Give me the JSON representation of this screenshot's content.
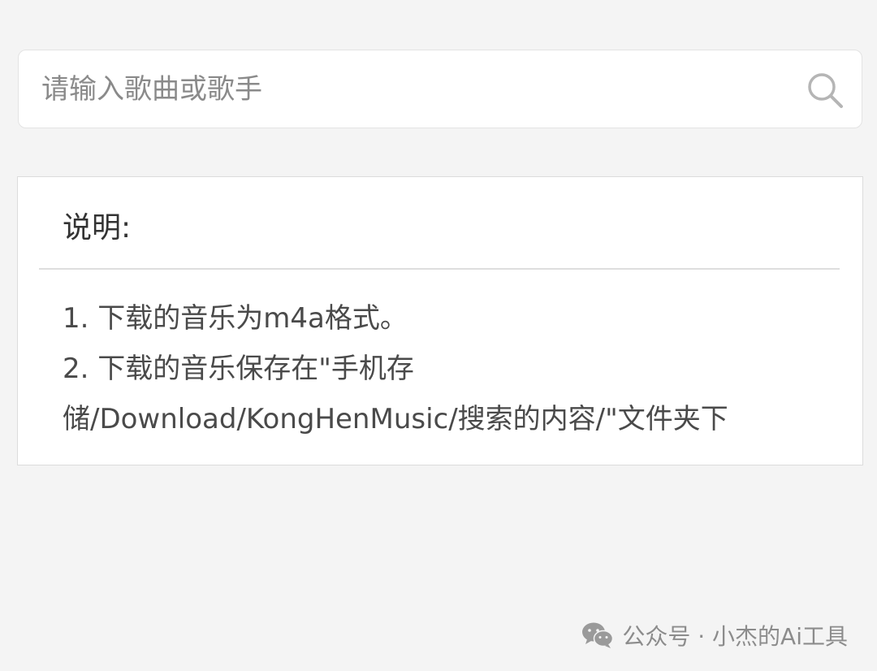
{
  "search": {
    "placeholder": "请输入歌曲或歌手",
    "icon": "search-icon"
  },
  "info": {
    "title": "说明:",
    "items": [
      "1. 下载的音乐为m4a格式。",
      "2. 下载的音乐保存在\"手机存",
      "储/Download/KongHenMusic/搜索的内容/\"文件夹下"
    ]
  },
  "footer": {
    "icon": "wechat-icon",
    "text": "公众号 · 小杰的Ai工具"
  },
  "colors": {
    "background": "#f4f4f4",
    "card": "#ffffff",
    "text": "#4a4a4a",
    "muted": "#8c8c8c"
  }
}
